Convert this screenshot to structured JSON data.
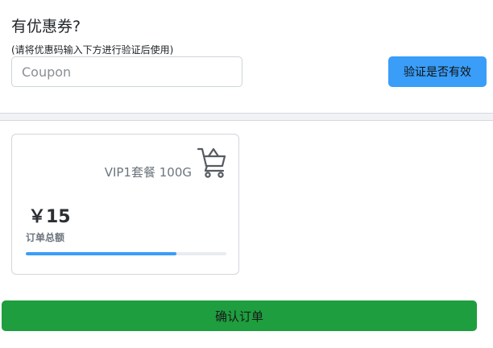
{
  "coupon": {
    "title": "有优惠券?",
    "hint": "(请将优惠码输入下方进行验证后使用)",
    "input_placeholder": "Coupon",
    "input_value": "",
    "verify_label": "验证是否有效"
  },
  "plan": {
    "name": "VIP1套餐 100G",
    "price": "￥15",
    "price_label": "订单总额",
    "progress": 0.75,
    "cart_icon": "shopping-cart-icon"
  },
  "order": {
    "confirm_label": "确认订单"
  },
  "colors": {
    "primary": "#3a9df8",
    "success": "#1e9e3e",
    "muted_text": "#6c757d"
  }
}
